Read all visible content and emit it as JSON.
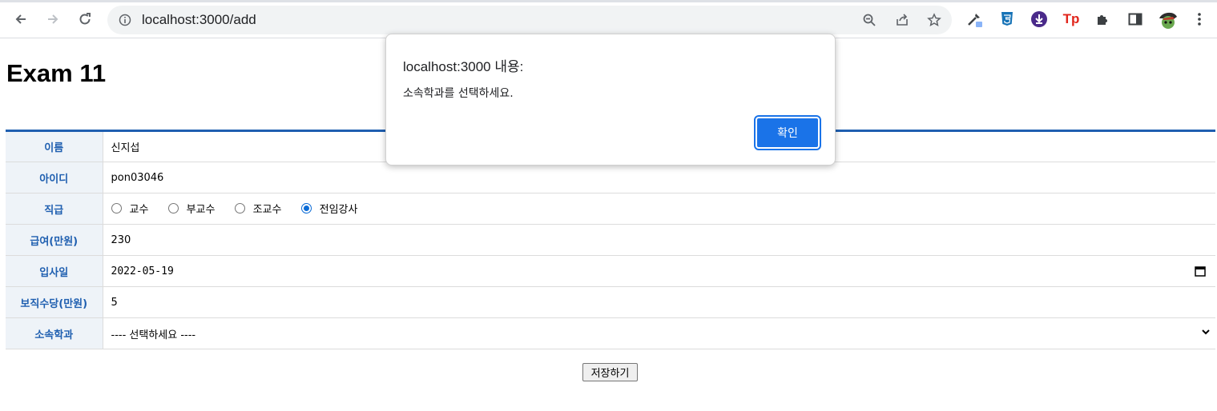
{
  "browser": {
    "url": "localhost:3000/add",
    "icons": [
      "back-icon",
      "forward-icon",
      "reload-icon",
      "info-icon",
      "zoom-icon",
      "share-icon",
      "star-icon",
      "eyedropper-icon",
      "css3-icon",
      "download-icon",
      "tp-icon",
      "puzzle-icon",
      "sidepanel-icon",
      "avatar",
      "more-icon"
    ],
    "ext_tp_label": "Tp"
  },
  "page": {
    "title": "Exam 11",
    "form": {
      "name_label": "이름",
      "name_value": "신지섭",
      "id_label": "아이디",
      "id_value": "pon03046",
      "position_label": "직급",
      "position_options": [
        "교수",
        "부교수",
        "조교수",
        "전임강사"
      ],
      "position_selected": "전임강사",
      "salary_label": "급여(만원)",
      "salary_value": "230",
      "hiredate_label": "입사일",
      "hiredate_value": "2022-05-19",
      "allowance_label": "보직수당(만원)",
      "allowance_value": "5",
      "dept_label": "소속학과",
      "dept_value": "---- 선택하세요 ----"
    },
    "save_label": "저장하기"
  },
  "dialog": {
    "title": "localhost:3000 내용:",
    "message": "소속학과를 선택하세요.",
    "ok_label": "확인"
  },
  "colors": {
    "accent": "#1f5fb0",
    "label_bg": "#eef3f8",
    "dialog_button": "#1a73e8"
  }
}
